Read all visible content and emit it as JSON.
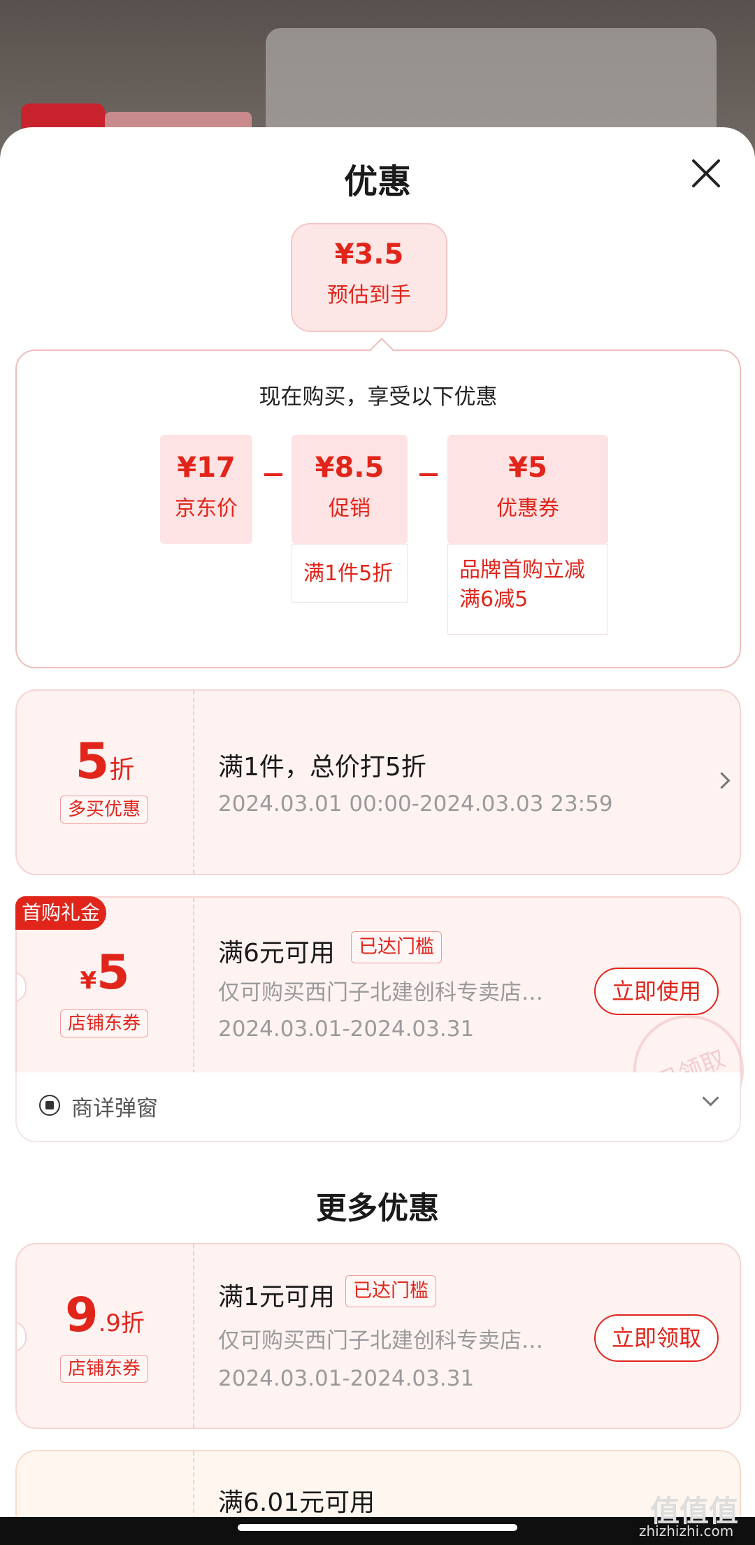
{
  "sheet": {
    "title": "优惠"
  },
  "estimate": {
    "price": "¥3.5",
    "label": "预估到手"
  },
  "calc": {
    "heading": "现在购买，享受以下优惠",
    "items": [
      {
        "price": "¥17",
        "label": "京东价",
        "desc": ""
      },
      {
        "price": "¥8.5",
        "label": "促销",
        "desc": "满1件5折"
      },
      {
        "price": "¥5",
        "label": "优惠券",
        "desc_line1": "品牌首购立减",
        "desc_line2": "满6减5"
      }
    ]
  },
  "coupon1": {
    "big": "5",
    "unit": "折",
    "tag": "多买优惠",
    "title": "满1件，总价打5折",
    "period": "2024.03.01 00:00-2024.03.03 23:59"
  },
  "coupon2": {
    "corner_tag": "首购礼金",
    "currency": "¥",
    "big": "5",
    "tag": "店铺东券",
    "title": "满6元可用",
    "badge": "已达门槛",
    "scope": "仅可购买西门子北建创科专卖店…",
    "period": "2024.03.01-2024.03.31",
    "button": "立即使用",
    "stamp": "已领取"
  },
  "popup_row": {
    "label": "商详弹窗"
  },
  "more": {
    "title": "更多优惠"
  },
  "coupon3": {
    "big": "9",
    "small": ".9折",
    "tag": "店铺东券",
    "title": "满1元可用",
    "badge": "已达门槛",
    "scope": "仅可购买西门子北建创科专卖店…",
    "period": "2024.03.01-2024.03.31",
    "button": "立即领取"
  },
  "coupon4": {
    "title": "满6.01元可用"
  },
  "watermark": {
    "main": "值值值",
    "url": "zhizhizhi.com"
  }
}
